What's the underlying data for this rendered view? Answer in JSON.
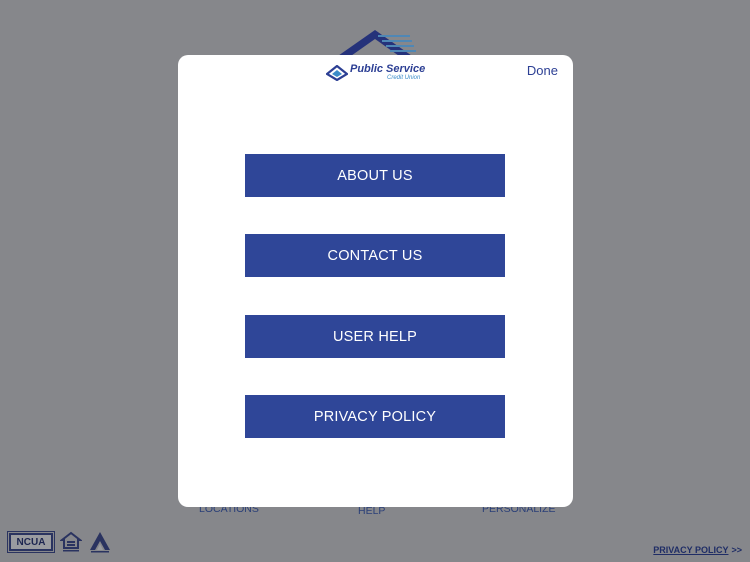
{
  "background": {
    "nav": {
      "locations": "LOCATIONS",
      "help": "HELP",
      "personalize": "PERSONALIZE"
    },
    "footer": {
      "ncua_label": "NCUA",
      "privacy_link": "PRIVACY POLICY",
      "privacy_arrows": ">>"
    }
  },
  "modal": {
    "logo": {
      "title": "Public Service",
      "subtitle": "Credit Union"
    },
    "done_label": "Done",
    "menu": [
      {
        "label": "ABOUT US"
      },
      {
        "label": "CONTACT US"
      },
      {
        "label": "USER HELP"
      },
      {
        "label": "PRIVACY POLICY"
      }
    ]
  },
  "colors": {
    "overlay_background": "#86878b",
    "button_blue": "#2f4698",
    "brand_blue": "#2c3f94",
    "brand_light_blue": "#3b8cc9"
  }
}
